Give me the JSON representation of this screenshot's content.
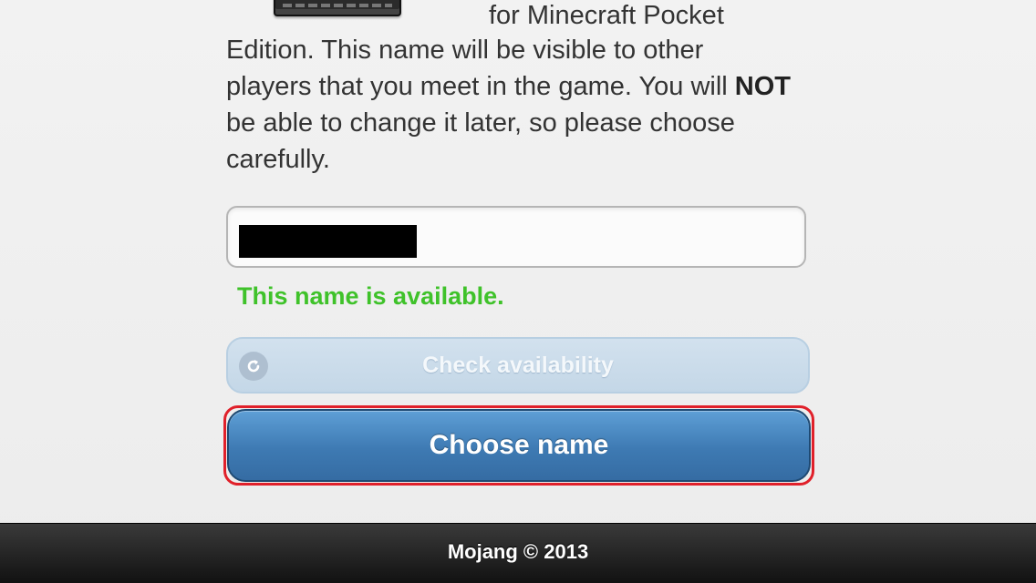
{
  "intro": {
    "line1_right": "for Minecraft Pocket",
    "part1": "Edition. This name will be visible to other players that you meet in the game. You will ",
    "emphasis": "NOT",
    "part2": " be able to change it later, so please choose carefully."
  },
  "name_field": {
    "value": ""
  },
  "status": {
    "message": "This name is available.",
    "color": "#3fc22a"
  },
  "check_button": {
    "label": "Check availability",
    "icon": "refresh-icon"
  },
  "choose_button": {
    "label": "Choose name"
  },
  "footer": {
    "text": "Mojang © 2013"
  }
}
